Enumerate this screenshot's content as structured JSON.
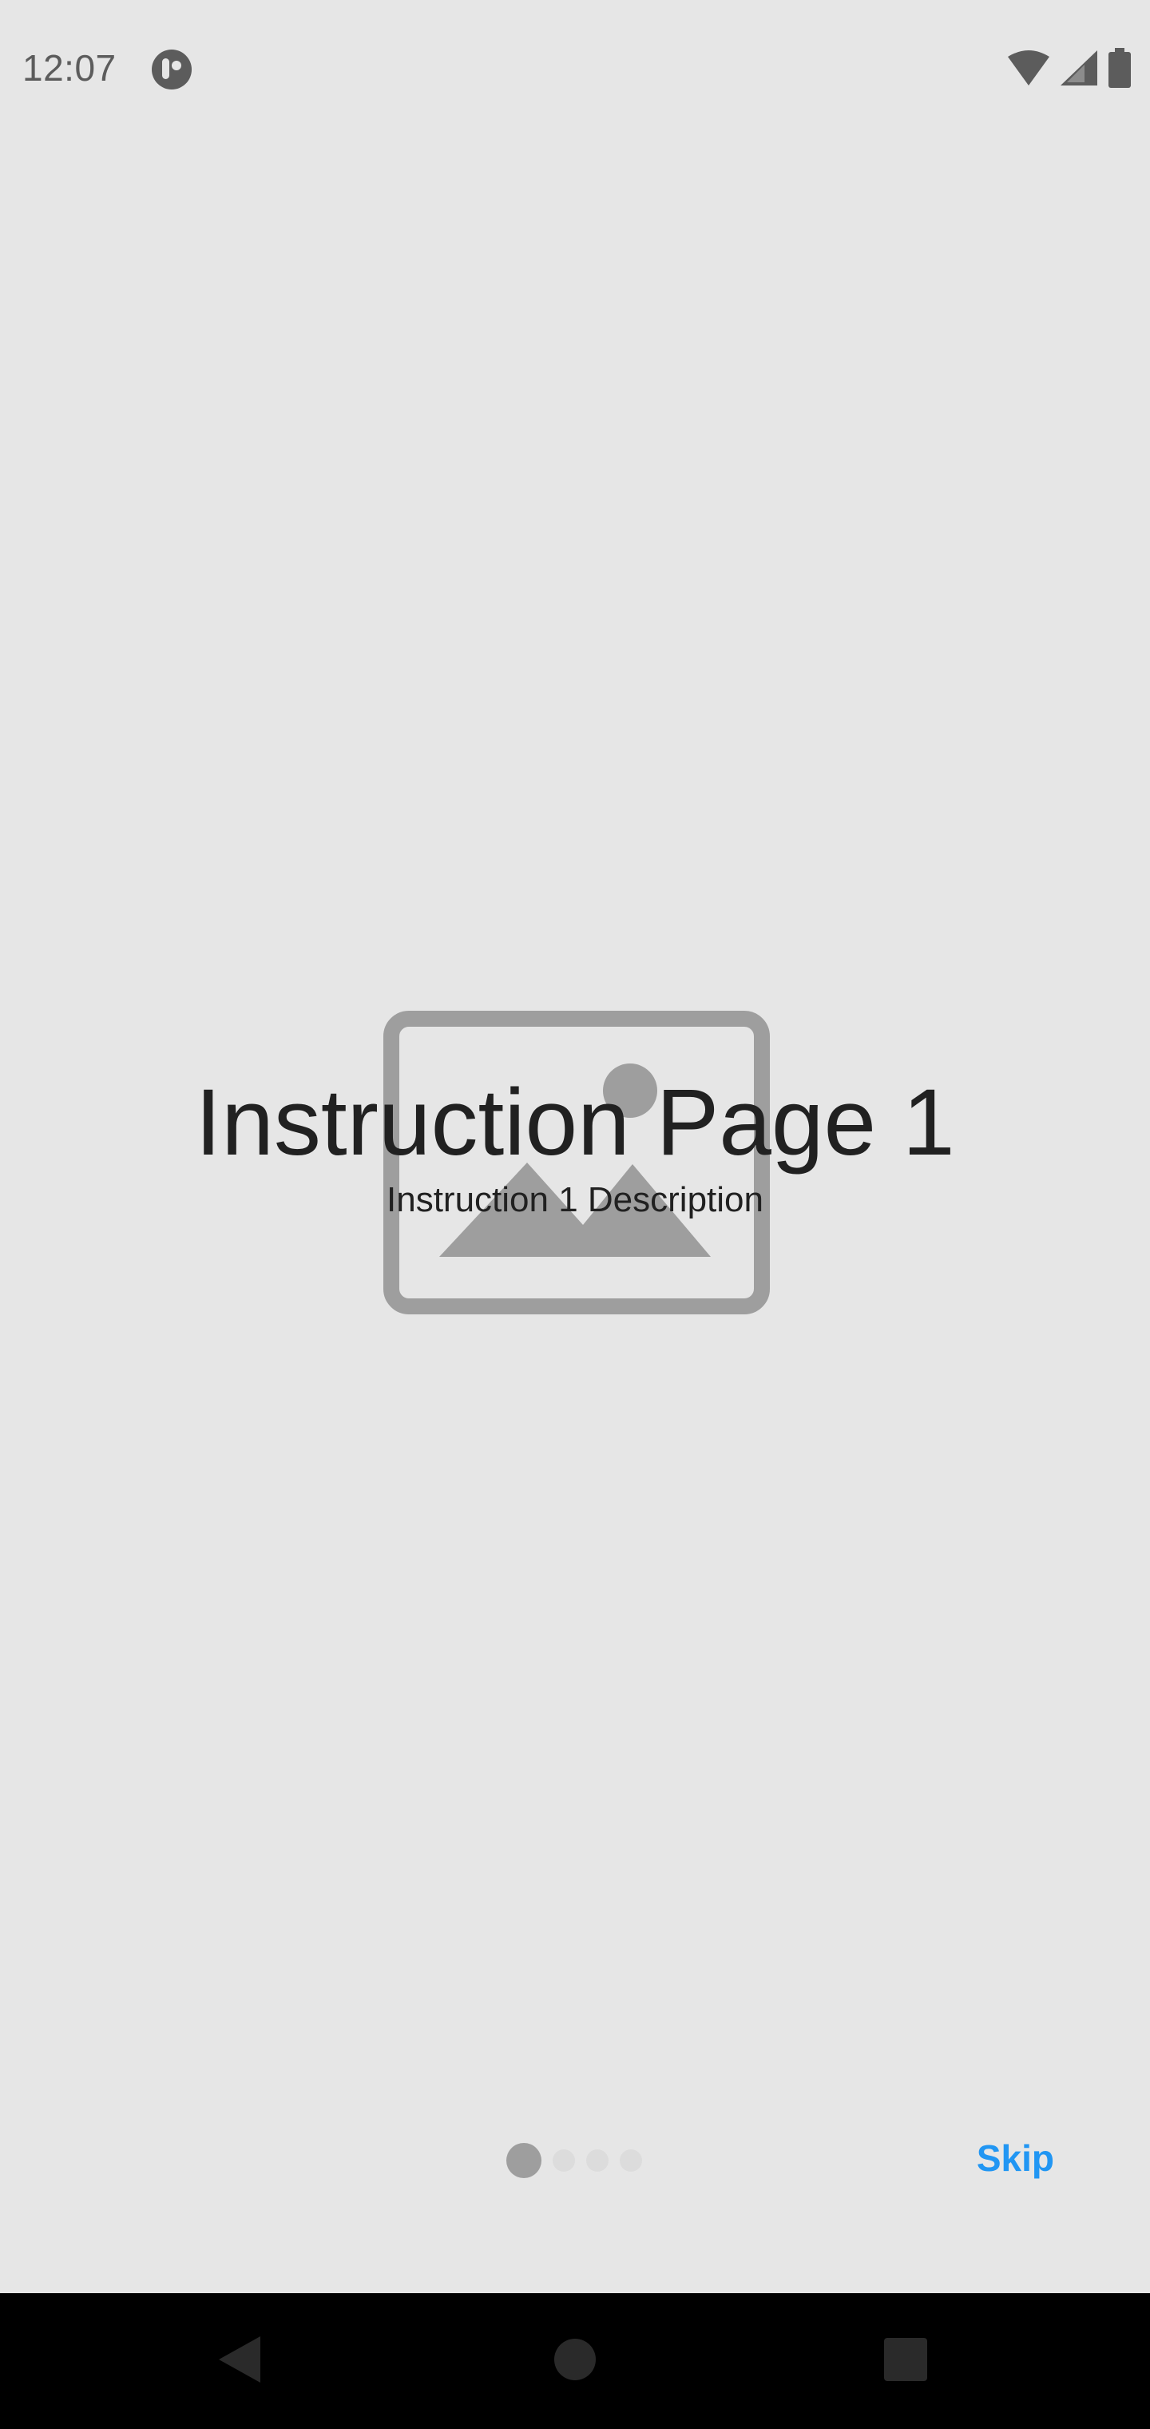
{
  "status_bar": {
    "time": "12:07",
    "icons": [
      "app-notification-icon",
      "wifi-icon",
      "cellular-signal-icon",
      "battery-icon"
    ]
  },
  "instruction": {
    "title": "Instruction Page 1",
    "description": "Instruction 1 Description",
    "image_icon": "image-placeholder-icon"
  },
  "pager": {
    "total_pages": 4,
    "current_page": 1,
    "skip_label": "Skip"
  },
  "nav_bar": {
    "icons": [
      "back-icon",
      "home-icon",
      "recents-icon"
    ]
  },
  "colors": {
    "background": "#e6e6e6",
    "accent": "#2196f3",
    "text": "#212121",
    "placeholder": "#9e9e9e"
  }
}
